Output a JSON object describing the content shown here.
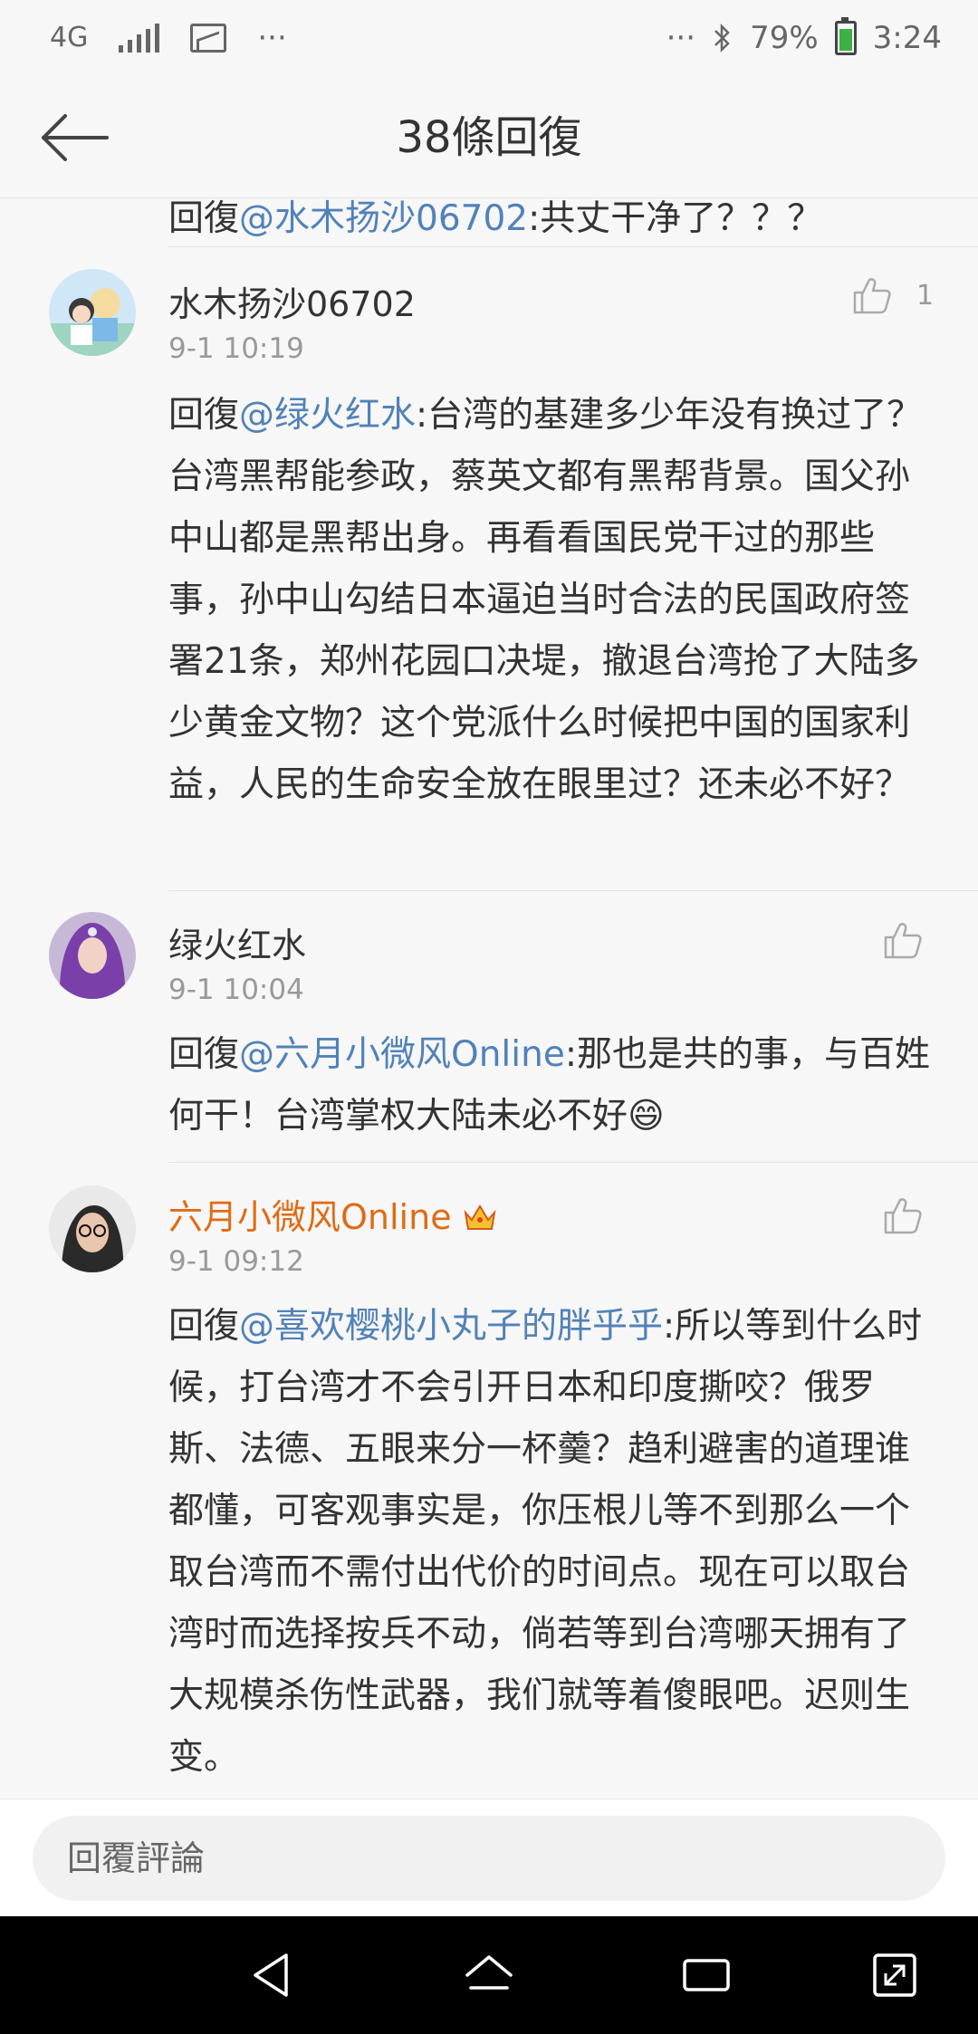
{
  "status_bar": {
    "network": "4G",
    "more_left": "···",
    "more_right": "···",
    "battery": "79%",
    "time": "3:24"
  },
  "header": {
    "title": "38條回復"
  },
  "partial_comment": {
    "prefix": "回復",
    "mention": "@水木扬沙06702",
    "text": ":共丈干净了？？？"
  },
  "comments": [
    {
      "name": "水木扬沙06702",
      "time": "9-1 10:19",
      "likes": "1",
      "prefix": "回復",
      "mention": "@绿火红水",
      "text": ":台湾的基建多少年没有换过了？台湾黑帮能参政，蔡英文都有黑帮背景。国父孙中山都是黑帮出身。再看看国民党干过的那些事，孙中山勾结日本逼迫当时合法的民国政府签署21条，郑州花园口决堤，撤退台湾抢了大陆多少黄金文物？这个党派什么时候把中国的国家利益，人民的生命安全放在眼里过？还未必不好？"
    },
    {
      "name": "绿火红水",
      "time": "9-1 10:04",
      "likes": "",
      "prefix": "回復",
      "mention": "@六月小微风Online",
      "text": ":那也是共的事，与百姓何干！台湾掌权大陆未必不好",
      "emoji": "😄"
    },
    {
      "name": "六月小微风Online",
      "time": "9-1 09:12",
      "likes": "",
      "prefix": "回復",
      "mention": "@喜欢樱桃小丸子的胖乎乎",
      "text": ":所以等到什么时候，打台湾才不会引开日本和印度撕咬？俄罗斯、法德、五眼来分一杯羹？趋利避害的道理谁都懂，可客观事实是，你压根儿等不到那么一个取台湾而不需付出代价的时间点。现在可以取台湾时而选择按兵不动，倘若等到台湾哪天拥有了大规模杀伤性武器，我们就等着傻眼吧。迟则生变。"
    }
  ],
  "reply_bar": {
    "placeholder": "回覆評論"
  },
  "colors": {
    "mention": "#5182b8",
    "vip_name": "#e06b14",
    "timestamp": "#999999"
  }
}
